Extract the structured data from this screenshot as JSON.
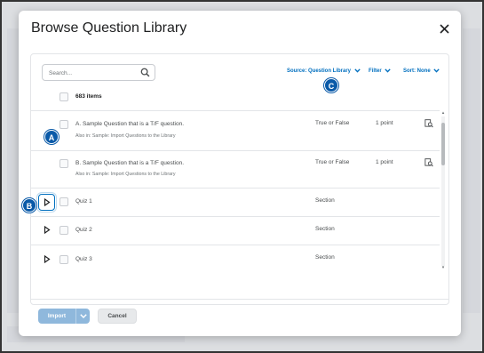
{
  "modal": {
    "title": "Browse Question Library",
    "close_icon": "close-icon"
  },
  "toolbar": {
    "search_placeholder": "Search...",
    "source_label": "Source: Question Library",
    "filter_label": "Filter",
    "sort_label": "Sort: None"
  },
  "list": {
    "items_count": "683 items",
    "rows": [
      {
        "title": "A. Sample Question that is a T/F question.",
        "also_in": "Also in: Sample: Import Questions to the Library",
        "type": "True or False",
        "points": "1 point"
      },
      {
        "title": "B. Sample Question that is a T/F question.",
        "also_in": "Also in: Sample: Import Questions to the Library",
        "type": "True or False",
        "points": "1 point"
      },
      {
        "title": "Quiz 1",
        "type": "Section"
      },
      {
        "title": "Quiz 2",
        "type": "Section"
      },
      {
        "title": "Quiz 3",
        "type": "Section"
      }
    ]
  },
  "footer": {
    "import_label": "Import",
    "cancel_label": "Cancel"
  },
  "callouts": {
    "a": "A",
    "b": "B",
    "c": "C"
  },
  "colors": {
    "accent": "#006fbf",
    "callout": "#0a5aa8"
  }
}
